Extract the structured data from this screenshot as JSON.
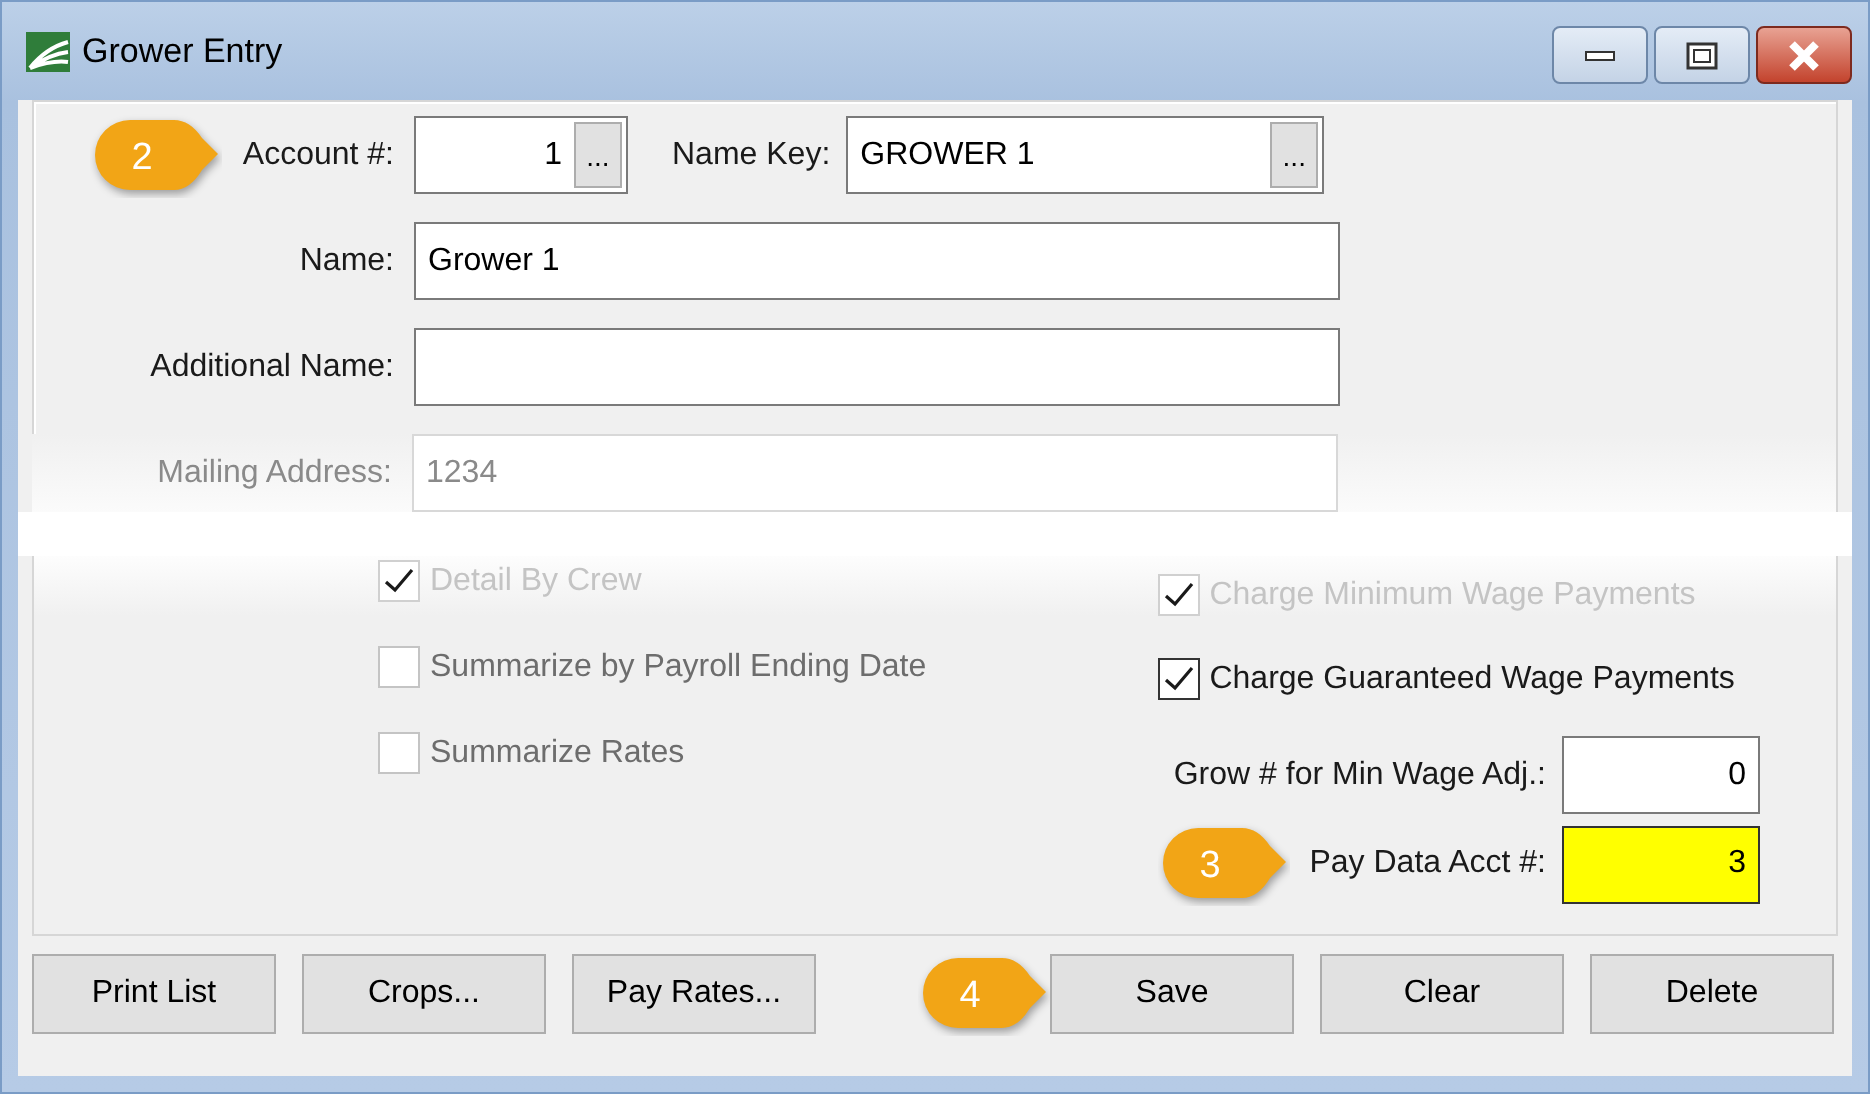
{
  "window": {
    "title": "Grower Entry"
  },
  "account": {
    "label": "Account #:",
    "value": "1",
    "lookup_button": "...",
    "callout": "2"
  },
  "name_key": {
    "label": "Name Key:",
    "value": "GROWER 1",
    "lookup_button": "..."
  },
  "name": {
    "label": "Name:",
    "value": "Grower 1"
  },
  "additional_name": {
    "label": "Additional Name:"
  },
  "mailing_address": {
    "label": "Mailing Address:",
    "value": "1234",
    "faded": true
  },
  "left_options": [
    {
      "label": "Detail By Crew",
      "checked": true,
      "disabled": true,
      "faded": true
    },
    {
      "label": "Summarize by Payroll Ending Date",
      "checked": false,
      "disabled": true,
      "faded": false
    },
    {
      "label": "Summarize Rates",
      "checked": false,
      "disabled": true,
      "faded": false
    }
  ],
  "right_options": [
    {
      "label": "Charge Minimum Wage Payments",
      "checked": true,
      "disabled": false,
      "faded": true
    },
    {
      "label": "Charge Guaranteed Wage Payments",
      "checked": true,
      "disabled": false,
      "faded": false
    }
  ],
  "grow_min_wage": {
    "label": "Grow # for Min Wage Adj.:",
    "value": "0"
  },
  "pay_data_acct": {
    "label": "Pay Data Acct #:",
    "value": "3",
    "highlighted": true,
    "callout": "3"
  },
  "buttons": [
    {
      "label": "Print List"
    },
    {
      "label": "Crops..."
    },
    {
      "label": "Pay Rates..."
    },
    {
      "label": "Save",
      "callout": "4"
    },
    {
      "label": "Clear"
    },
    {
      "label": "Delete"
    }
  ]
}
